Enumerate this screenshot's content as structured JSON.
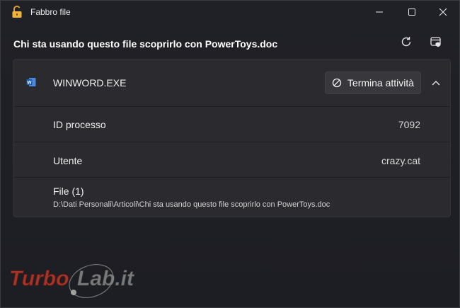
{
  "window": {
    "title": "Fabbro file",
    "heading": "Chi sta usando questo file scoprirlo con PowerToys.doc"
  },
  "titlebar_icons": [
    "padlock-icon",
    "minimize-icon",
    "maximize-icon",
    "close-icon"
  ],
  "toolbar_icons": [
    "refresh-icon",
    "admin-restart-icon"
  ],
  "process": {
    "name": "WINWORD.EXE",
    "icon": "word-icon",
    "end_task_label": "Termina attività",
    "end_task_icon": "block-icon",
    "expanded_icon": "chevron-up-icon",
    "pid_label": "ID processo",
    "pid_value": "7092",
    "user_label": "Utente",
    "user_value": "crazy.cat",
    "files_label": "File (1)",
    "file_path": "D:\\Dati Personali\\Articoli\\Chi sta usando questo file scoprirlo con PowerToys.doc"
  },
  "watermark": {
    "text": "TurboLab.it",
    "part1": "Turbo",
    "part2": "Lab.it"
  },
  "colors": {
    "background": "#1c1d22",
    "card": "#2b2b2f",
    "button": "#38383c",
    "watermark_red": "#c0392b",
    "watermark_grey": "#8a8a8a"
  }
}
